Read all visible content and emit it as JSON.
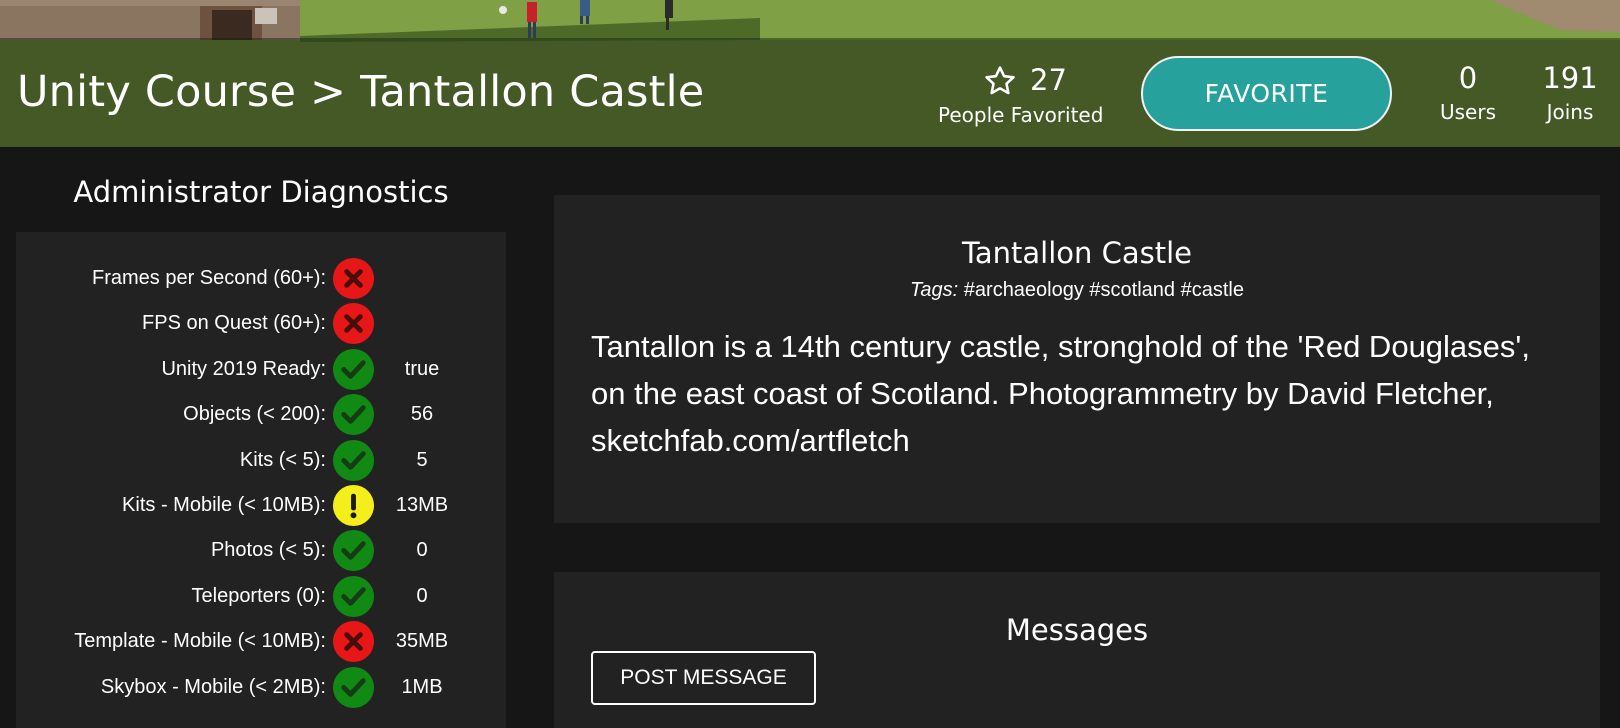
{
  "header": {
    "breadcrumb": "Unity Course > Tantallon Castle",
    "favorites": {
      "count": "27",
      "label": "People Favorited",
      "icon": "star-outline-icon"
    },
    "favorite_button": "FAVORITE",
    "stats": [
      {
        "value": "0",
        "label": "Users"
      },
      {
        "value": "191",
        "label": "Joins"
      }
    ]
  },
  "diagnostics": {
    "title": "Administrator Diagnostics",
    "rows": [
      {
        "label": "Frames per Second (60+):",
        "status": "fail",
        "value": ""
      },
      {
        "label": "FPS on Quest (60+):",
        "status": "fail",
        "value": ""
      },
      {
        "label": "Unity 2019 Ready:",
        "status": "pass",
        "value": "true"
      },
      {
        "label": "Objects (< 200):",
        "status": "pass",
        "value": "56"
      },
      {
        "label": "Kits (< 5):",
        "status": "pass",
        "value": "5"
      },
      {
        "label": "Kits - Mobile (< 10MB):",
        "status": "warn",
        "value": "13MB"
      },
      {
        "label": "Photos (< 5):",
        "status": "pass",
        "value": "0"
      },
      {
        "label": "Teleporters (0):",
        "status": "pass",
        "value": "0"
      },
      {
        "label": "Template - Mobile (< 10MB):",
        "status": "fail",
        "value": "35MB"
      },
      {
        "label": "Skybox - Mobile (< 2MB):",
        "status": "pass",
        "value": "1MB"
      }
    ],
    "colors": {
      "pass": "#118a14",
      "fail": "#e81717",
      "warn": "#f4ef1a"
    }
  },
  "world": {
    "name": "Tantallon Castle",
    "tags_label": "Tags:",
    "tags": "#archaeology #scotland #castle",
    "description": "Tantallon is a 14th century castle, stronghold of the 'Red Douglases', on the east coast of Scotland. Photogrammetry by David Fletcher, sketchfab.com/artfletch"
  },
  "messages": {
    "title": "Messages",
    "post_button": "POST MESSAGE"
  },
  "theme": {
    "accent": "#26a19b",
    "background": "#161616",
    "card": "#222222"
  }
}
